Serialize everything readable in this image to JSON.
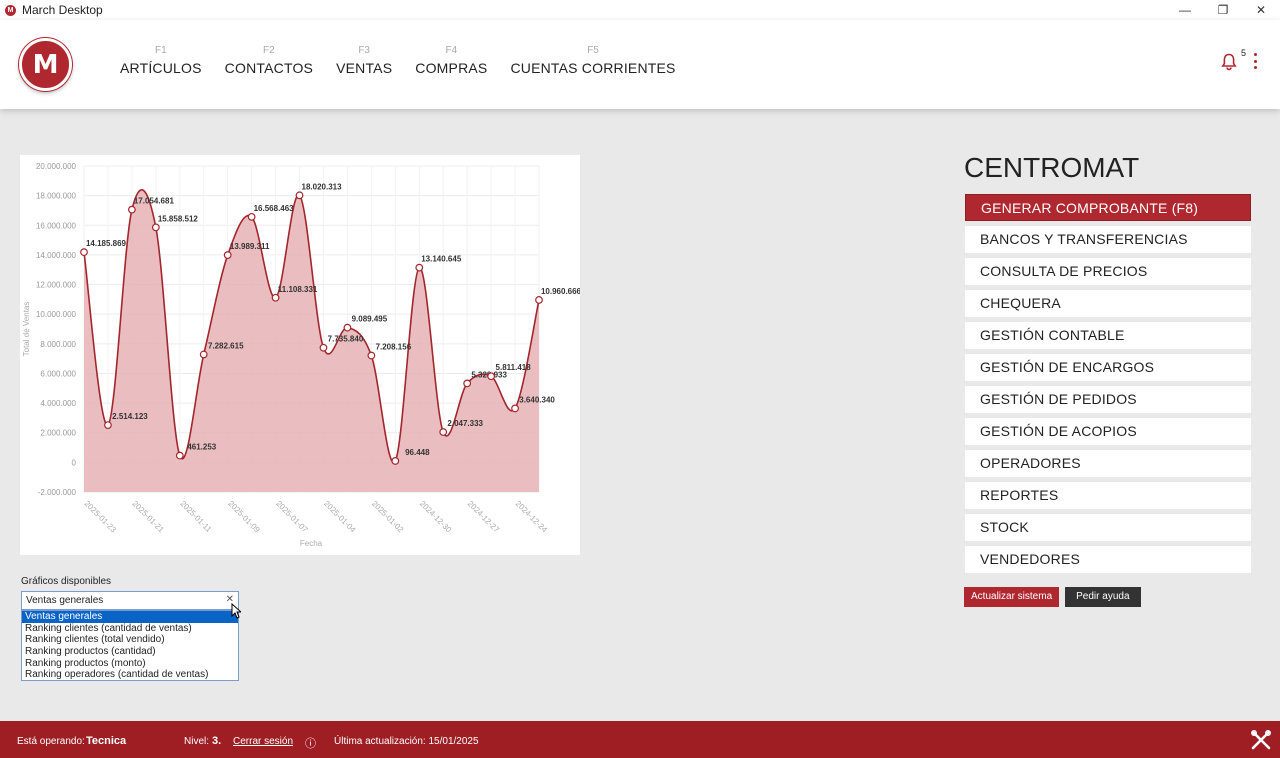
{
  "window": {
    "title": "March Desktop",
    "controls": [
      "—",
      "❐",
      "✕"
    ]
  },
  "header": {
    "logo": "M",
    "nav": [
      {
        "key": "F1",
        "label": "ARTÍCULOS"
      },
      {
        "key": "F2",
        "label": "CONTACTOS"
      },
      {
        "key": "F3",
        "label": "VENTAS"
      },
      {
        "key": "F4",
        "label": "COMPRAS"
      },
      {
        "key": "F5",
        "label": "CUENTAS CORRIENTES"
      }
    ],
    "notifications_count": "5"
  },
  "chart_data": {
    "type": "area",
    "xlabel": "Fecha",
    "ylabel": "Total de Ventas",
    "ylim": [
      -2000000,
      20000000
    ],
    "yticks": [
      "20.000.000",
      "18.000.000",
      "16.000.000",
      "14.000.000",
      "12.000.000",
      "10.000.000",
      "8.000.000",
      "6.000.000",
      "4.000.000",
      "2.000.000",
      "0",
      "-2.000.000"
    ],
    "ytick_values": [
      20000000,
      18000000,
      16000000,
      14000000,
      12000000,
      10000000,
      8000000,
      6000000,
      4000000,
      2000000,
      0,
      -2000000
    ],
    "xtick_labels": [
      "2025-01-23",
      "2025-01-21",
      "2025-01-11",
      "2025-01-09",
      "2025-01-07",
      "2025-01-04",
      "2025-01-02",
      "2024-12-30",
      "2024-12-27",
      "2024-12-24"
    ],
    "values": [
      14185869,
      2514123,
      17054681,
      15858512,
      461253,
      7282615,
      13989311,
      16568463,
      11108331,
      18020313,
      7735840,
      9089495,
      7208156,
      96448,
      13140645,
      2047333,
      5328933,
      5811418,
      3640340,
      10960666
    ],
    "labels": [
      "14.185.869",
      "2.514.123",
      "17.054.681",
      "15.858.512",
      "461.253",
      "7.282.615",
      "13.989.311",
      "16.568.463",
      "11.108.331",
      "18.020.313",
      "7.735.840",
      "9.089.495",
      "7.208.156",
      "96.448",
      "13.140.645",
      "2.047.333",
      "5.328.933",
      "5.811.418",
      "3.640.340",
      "10.960.666"
    ],
    "grid": true
  },
  "chart_selector": {
    "label": "Gráficos disponibles",
    "selected": "Ventas generales",
    "options": [
      "Ventas generales",
      "Ranking clientes (cantidad de ventas)",
      "Ranking clientes (total vendido)",
      "Ranking productos (cantidad)",
      "Ranking productos (monto)",
      "Ranking operadores (cantidad de ventas)"
    ]
  },
  "right_panel": {
    "company": "CENTROMAT",
    "menu": [
      "GENERAR COMPROBANTE (F8)",
      "BANCOS Y TRANSFERENCIAS",
      "CONSULTA DE PRECIOS",
      "CHEQUERA",
      "GESTIÓN CONTABLE",
      "GESTIÓN DE ENCARGOS",
      "GESTIÓN DE PEDIDOS",
      "GESTIÓN DE ACOPIOS",
      "OPERADORES",
      "REPORTES",
      "STOCK",
      "VENDEDORES"
    ],
    "update_button": "Actualizar sistema",
    "help_button": "Pedir ayuda"
  },
  "footer": {
    "operating_label": "Está operando:",
    "operator": "Tecnica",
    "level_label": "Nivel:",
    "level": "3.",
    "logout": "Cerrar sesión",
    "info_icon": "ⓘ",
    "last_update": "Última actualización: 15/01/2025"
  },
  "colors": {
    "brand": "#b0282f",
    "footer": "#9e1e24",
    "area": "#e6b3b5",
    "line": "#a3262d"
  }
}
